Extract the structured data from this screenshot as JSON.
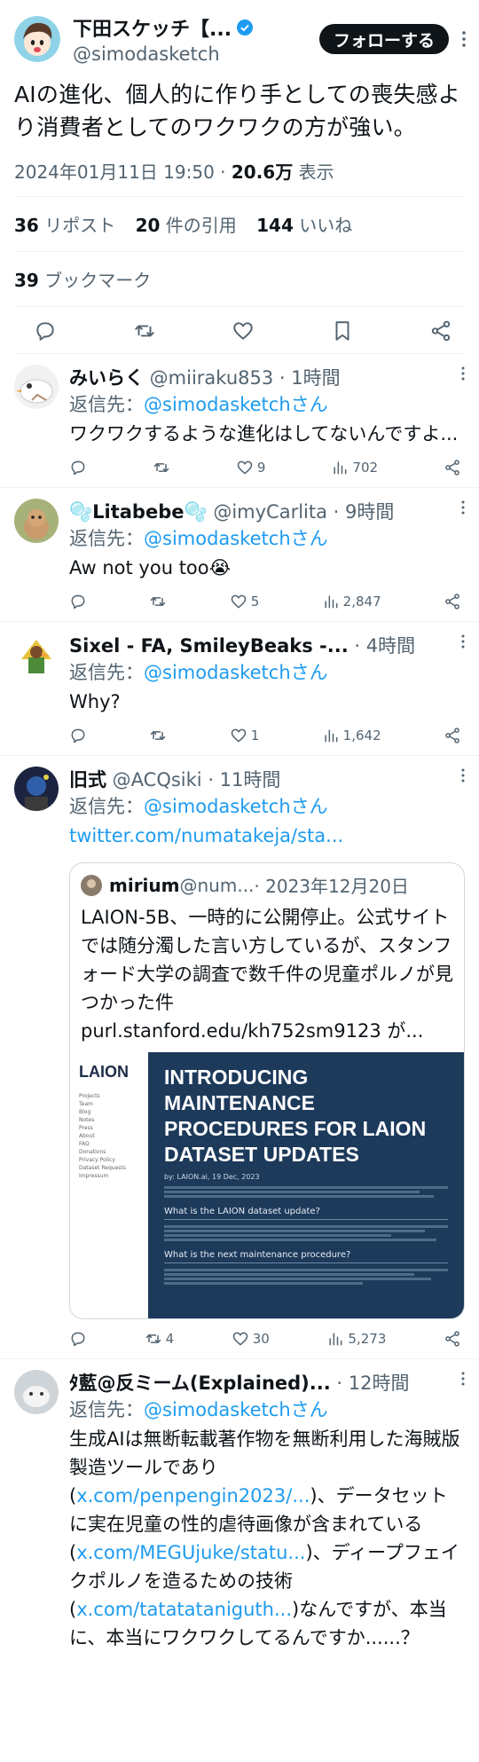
{
  "main_tweet": {
    "name": "下田スケッチ【...",
    "handle": "@simodasketch",
    "follow_label": "フォローする",
    "text": "AIの進化、個人的に作り手としての喪失感より消費者としてのワクワクの方が強い。",
    "timestamp": "2024年01月11日 19:50",
    "dot": " · ",
    "views_count": "20.6万",
    "views_label": " 表示",
    "reposts_count": "36",
    "reposts_label": " リポスト",
    "quotes_count": "20",
    "quotes_label": " 件の引用",
    "likes_count": "144",
    "likes_label": " いいね",
    "bookmarks_count": "39",
    "bookmarks_label": " ブックマーク"
  },
  "replies": [
    {
      "name": "みいらく",
      "handle": " @miiraku853",
      "time": " · 1時間",
      "reply_to_label": "返信先：",
      "reply_to": "@simodasketchさん",
      "text": "ワクワクするような進化はしてないんですよ...",
      "likes": "9",
      "views": "702"
    },
    {
      "name": "🫧Litabebe🫧",
      "handle": " @imyCarlita",
      "time": " · 9時間",
      "reply_to_label": "返信先：",
      "reply_to": "@simodasketchさん",
      "text": "Aw not you too😭",
      "likes": "5",
      "views": "2,847"
    },
    {
      "name": "Sixel - FA, SmileyBeaks -...",
      "handle": "",
      "time": " · 4時間",
      "reply_to_label": "返信先：",
      "reply_to": "@simodasketchさん",
      "text": "Why?",
      "likes": "1",
      "views": "1,642"
    },
    {
      "name": "旧式",
      "handle": " @ACQsiki",
      "time": " · 11時間",
      "reply_to_label": "返信先：",
      "reply_to": "@simodasketchさん",
      "link": "twitter.com/numatakeja/sta...",
      "retweets": "4",
      "likes": "30",
      "views": "5,273",
      "quote": {
        "name": "mirium",
        "handle": " @num...",
        "time": " · 2023年12月20日",
        "text": "LAION-5B、一時的に公開停止。公式サイトでは随分濁した言い方しているが、スタンフォード大学の調査で数千件の児童ポルノが見つかった件",
        "link": "purl.stanford.edu/kh752sm9123 が...",
        "image": {
          "logo": "LAION",
          "nav": [
            "Projects",
            "Team",
            "Blog",
            "Notes",
            "Press",
            "About",
            "FAQ",
            "Donations",
            "Privacy Policy",
            "Dataset Requests",
            "Impressum"
          ],
          "headline": "INTRODUCING MAINTENANCE PROCEDURES FOR LAION DATASET UPDATES",
          "byline": "by: LAION.ai, 19 Dec, 2023",
          "h1": "What is the LAION dataset update?",
          "h2": "What is the next maintenance procedure?"
        }
      }
    },
    {
      "name": "ﾀ藍@反ミーム(Explained)...",
      "handle": "",
      "time": " · 12時間",
      "reply_to_label": "返信先：",
      "reply_to": "@simodasketchさん",
      "text_1": "生成AIは無断転載著作物を無断利用した海賊版製造ツールであり(",
      "link_1": "x.com/penpengin2023/...",
      "text_2": ")、データセットに実在児童の性的虐待画像が含まれている(",
      "link_2": "x.com/MEGUjuke/statu...",
      "text_3": ")、ディープフェイクポルノを造るための技術(",
      "link_3": "x.com/tatatataniguth...",
      "text_4": ")なんですが、本当に、本当にワクワクしてるんですか......？"
    }
  ]
}
